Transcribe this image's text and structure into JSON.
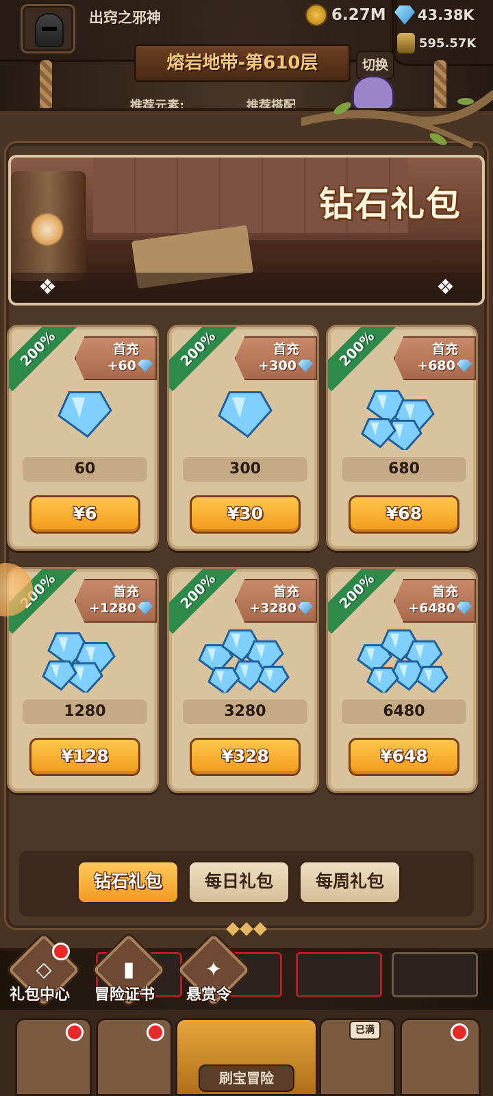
{
  "player": {
    "name": "出窍之邪神"
  },
  "resources": {
    "coins": "6.27M",
    "gems": "43.38K",
    "bag": "595.57K"
  },
  "level": {
    "title": "熔岩地带-第610层",
    "switch_label": "切换"
  },
  "recommend": {
    "left": "推荐元素:",
    "right": "推荐搭配"
  },
  "banner": {
    "title": "钻石礼包",
    "left_ornament": "❖",
    "right_ornament": "❖"
  },
  "packs": [
    {
      "badge": "200%",
      "first_label": "首充",
      "bonus": "+60",
      "amount": "60",
      "price": "¥6",
      "size": "small"
    },
    {
      "badge": "200%",
      "first_label": "首充",
      "bonus": "+300",
      "amount": "300",
      "price": "¥30",
      "size": "small"
    },
    {
      "badge": "200%",
      "first_label": "首充",
      "bonus": "+680",
      "amount": "680",
      "price": "¥68",
      "size": "medium"
    },
    {
      "badge": "200%",
      "first_label": "首充",
      "bonus": "+1280",
      "amount": "1280",
      "price": "¥128",
      "size": "medium"
    },
    {
      "badge": "200%",
      "first_label": "首充",
      "bonus": "+3280",
      "amount": "3280",
      "price": "¥328",
      "size": "large"
    },
    {
      "badge": "200%",
      "first_label": "首充",
      "bonus": "+6480",
      "amount": "6480",
      "price": "¥648",
      "size": "large"
    }
  ],
  "tabs": [
    {
      "label": "钻石礼包",
      "active": true
    },
    {
      "label": "每日礼包",
      "active": false
    },
    {
      "label": "每周礼包",
      "active": false
    }
  ],
  "collapse_arrows": "◆◆◆",
  "side": [
    {
      "label": "礼包中心",
      "icon": "diamond-icon",
      "glyph": "◇"
    },
    {
      "label": "冒险证书",
      "icon": "book-icon",
      "glyph": "▮"
    },
    {
      "label": "悬赏令",
      "icon": "bounty-icon",
      "glyph": "✦"
    }
  ],
  "nav": {
    "center_label": "刷宝冒险",
    "full_badge": "已满"
  },
  "colors": {
    "accent": "#f09a1c",
    "green_ribbon": "#2d8a4a",
    "card": "#d9c39c"
  }
}
